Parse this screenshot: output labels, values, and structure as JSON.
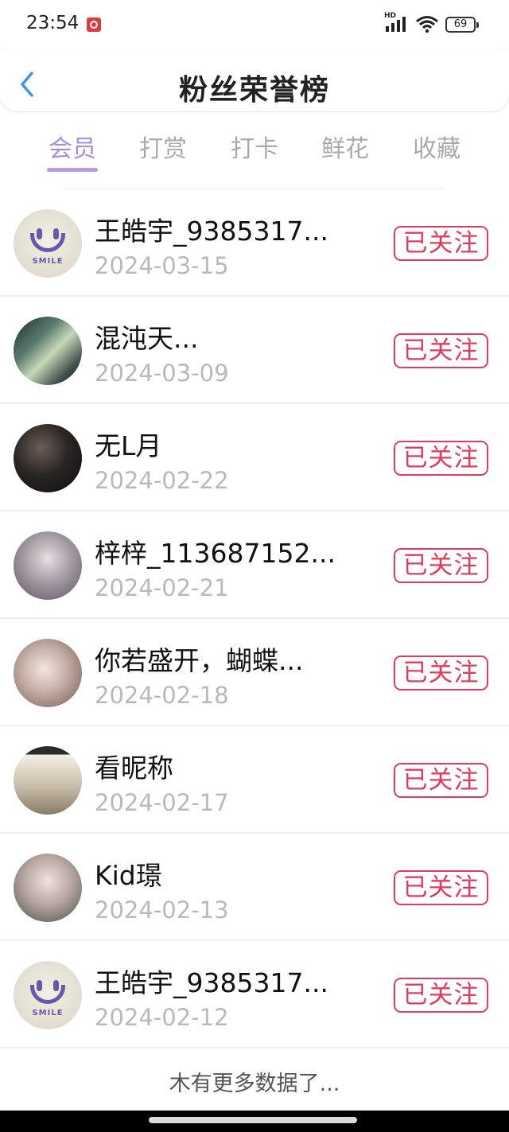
{
  "status_bar": {
    "time": "23:54",
    "network": "HD",
    "battery": "69"
  },
  "header": {
    "title": "粉丝荣誉榜"
  },
  "tabs": [
    {
      "label": "会员",
      "active": true
    },
    {
      "label": "打赏",
      "active": false
    },
    {
      "label": "打卡",
      "active": false
    },
    {
      "label": "鲜花",
      "active": false
    },
    {
      "label": "收藏",
      "active": false
    }
  ],
  "colors": {
    "accent": "#a98ee0",
    "follow": "#e23c5c",
    "muted": "#b9b9b9"
  },
  "fans": [
    {
      "name": "王皓宇_9385317...",
      "date": "2024-03-15",
      "button": "已关注",
      "avatar": "smile-avatar",
      "avatar_text": "SMILE"
    },
    {
      "name": "混沌天...",
      "date": "2024-03-09",
      "button": "已关注",
      "avatar": "photo-avatar"
    },
    {
      "name": "无L月",
      "date": "2024-02-22",
      "button": "已关注",
      "avatar": "photo-avatar"
    },
    {
      "name": "梓梓_113687152...",
      "date": "2024-02-21",
      "button": "已关注",
      "avatar": "photo-avatar"
    },
    {
      "name": "你若盛开，蝴蝶...",
      "date": "2024-02-18",
      "button": "已关注",
      "avatar": "photo-avatar"
    },
    {
      "name": "看昵称",
      "date": "2024-02-17",
      "button": "已关注",
      "avatar": "photo-avatar"
    },
    {
      "name": "Kid璟",
      "date": "2024-02-13",
      "button": "已关注",
      "avatar": "photo-avatar"
    },
    {
      "name": "王皓宇_9385317...",
      "date": "2024-02-12",
      "button": "已关注",
      "avatar": "smile-avatar",
      "avatar_text": "SMILE"
    }
  ],
  "footer": {
    "end_text": "木有更多数据了..."
  }
}
